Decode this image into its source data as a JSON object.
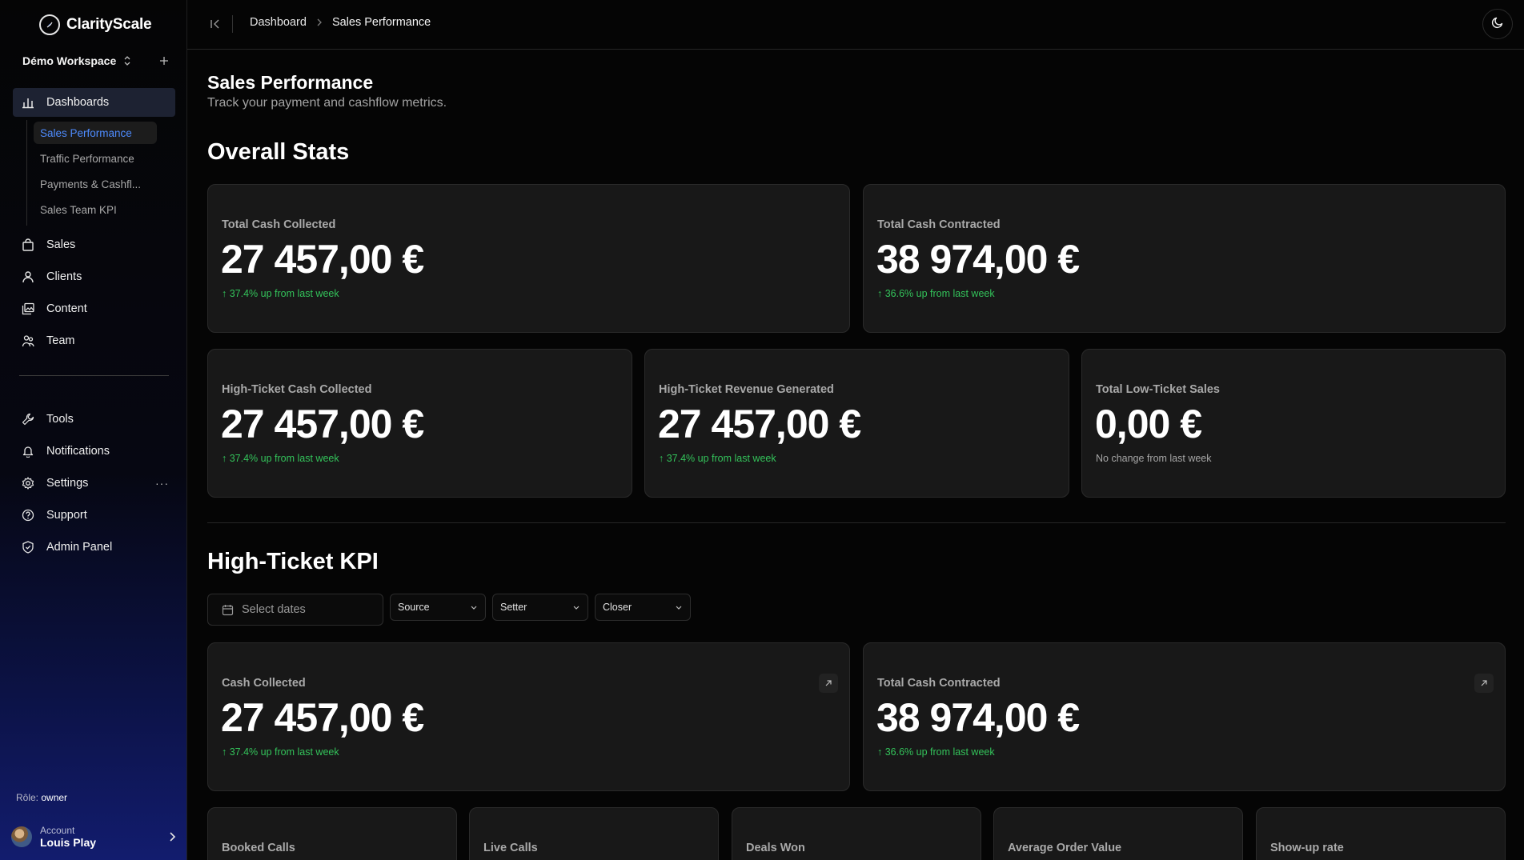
{
  "brand": {
    "name": "ClarityScale"
  },
  "workspace": {
    "name": "Démo Workspace"
  },
  "sidebar": {
    "main_items": [
      {
        "label": "Dashboards",
        "icon": "bar-chart-icon"
      },
      {
        "label": "Sales",
        "icon": "shopping-bag-icon"
      },
      {
        "label": "Clients",
        "icon": "user-icon"
      },
      {
        "label": "Content",
        "icon": "image-gallery-icon"
      },
      {
        "label": "Team",
        "icon": "team-icon"
      }
    ],
    "dashboards_sub": [
      {
        "label": "Sales Performance",
        "active": true
      },
      {
        "label": "Traffic Performance"
      },
      {
        "label": "Payments & Cashfl..."
      },
      {
        "label": "Sales Team KPI"
      }
    ],
    "secondary_items": [
      {
        "label": "Tools",
        "icon": "wrench-icon"
      },
      {
        "label": "Notifications",
        "icon": "bell-icon"
      },
      {
        "label": "Settings",
        "icon": "gear-icon",
        "more": "···"
      },
      {
        "label": "Support",
        "icon": "help-circle-icon"
      },
      {
        "label": "Admin Panel",
        "icon": "shield-icon"
      }
    ],
    "role_label": "Rôle:",
    "role_value": "owner",
    "account_label": "Account",
    "account_name": "Louis Play"
  },
  "breadcrumb": {
    "root": "Dashboard",
    "current": "Sales Performance"
  },
  "page": {
    "title": "Sales Performance",
    "subtitle": "Track your payment and cashflow metrics."
  },
  "overall_stats": {
    "title": "Overall Stats",
    "cards": [
      {
        "label": "Total Cash Collected",
        "value": "27 457,00 €",
        "delta": "↑ 37.4% up from last week"
      },
      {
        "label": "Total Cash Contracted",
        "value": "38 974,00 €",
        "delta": "↑ 36.6% up from last week"
      },
      {
        "label": "High-Ticket Cash Collected",
        "value": "27 457,00 €",
        "delta": "↑ 37.4% up from last week"
      },
      {
        "label": "High-Ticket Revenue Generated",
        "value": "27 457,00 €",
        "delta": "↑ 37.4% up from last week"
      },
      {
        "label": "Total Low-Ticket Sales",
        "value": "0,00 €",
        "delta": "No change from last week"
      }
    ]
  },
  "high_ticket_kpi": {
    "title": "High-Ticket KPI",
    "filters": {
      "date_placeholder": "Select dates",
      "source": "Source",
      "setter": "Setter",
      "closer": "Closer"
    },
    "cards": [
      {
        "label": "Cash Collected",
        "value": "27 457,00 €",
        "delta": "↑ 37.4% up from last week"
      },
      {
        "label": "Total Cash Contracted",
        "value": "38 974,00 €",
        "delta": "↑ 36.6% up from last week"
      }
    ],
    "mini_cards": [
      {
        "label": "Booked Calls"
      },
      {
        "label": "Live Calls"
      },
      {
        "label": "Deals Won"
      },
      {
        "label": "Average Order Value"
      },
      {
        "label": "Show-up rate"
      }
    ]
  },
  "colors": {
    "accent": "#4e8cff",
    "positive": "#33c25a",
    "background": "#050505",
    "card": "#181818"
  }
}
